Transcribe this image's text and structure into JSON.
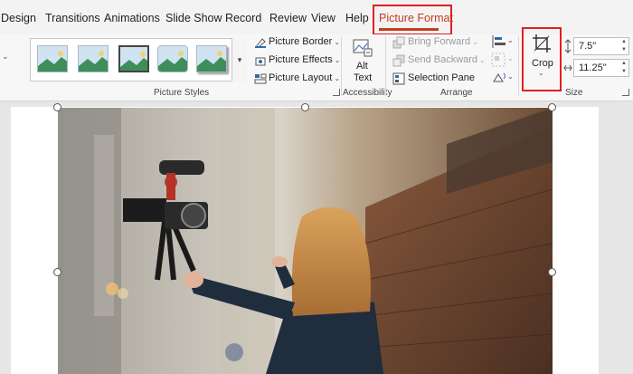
{
  "tabs": [
    "Design",
    "Transitions",
    "Animations",
    "Slide Show",
    "Record",
    "Review",
    "View",
    "Help",
    "Picture Format"
  ],
  "active_tab": "Picture Format",
  "ribbon": {
    "picture_styles": {
      "label": "Picture Styles",
      "buttons": {
        "border": "Picture Border",
        "effects": "Picture Effects",
        "layout": "Picture Layout"
      }
    },
    "accessibility": {
      "label": "Accessibility",
      "alt_line1": "Alt",
      "alt_line2": "Text"
    },
    "arrange": {
      "label": "Arrange",
      "bring_forward": "Bring Forward",
      "send_backward": "Send Backward",
      "selection_pane": "Selection Pane"
    },
    "size": {
      "label": "Size",
      "crop": "Crop",
      "height": "7.5\"",
      "width": "11.25\""
    }
  },
  "colors": {
    "accent": "#c43e1c",
    "highlight_box": "#e02020"
  }
}
